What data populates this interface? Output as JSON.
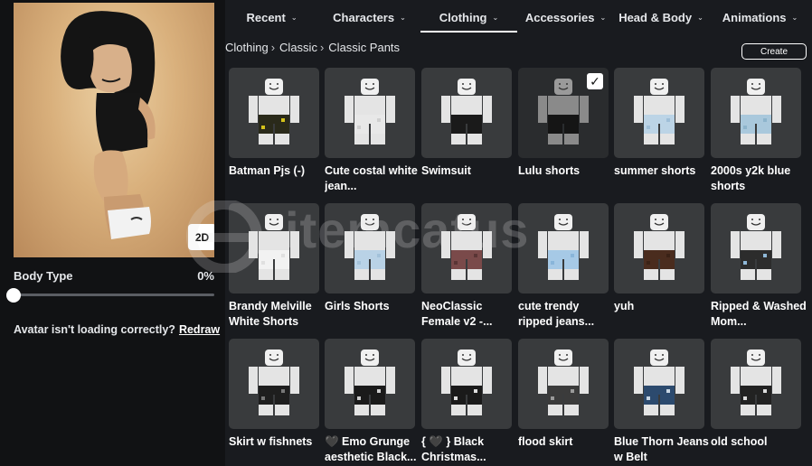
{
  "avatar": {
    "mode_button": "2D",
    "body_type_label": "Body Type",
    "body_type_value": "0%",
    "body_type_level": 0,
    "loading_note": "Avatar isn't loading correctly?",
    "redraw_label": "Redraw"
  },
  "tabs": [
    {
      "label": "Recent",
      "active": false
    },
    {
      "label": "Characters",
      "active": false
    },
    {
      "label": "Clothing",
      "active": true
    },
    {
      "label": "Accessories",
      "active": false
    },
    {
      "label": "Head & Body",
      "active": false
    },
    {
      "label": "Animations",
      "active": false
    }
  ],
  "breadcrumb": [
    "Clothing",
    "Classic",
    "Classic Pants"
  ],
  "create_label": "Create",
  "watermark": "itemcatus",
  "items": [
    {
      "name": "Batman Pjs (-)",
      "pants": "#2a2a1a",
      "accent": "#d4c21a",
      "selected": false
    },
    {
      "name": "Cute costal white jean...",
      "pants": "#e8e8e8",
      "accent": "#d0d0d0",
      "selected": false
    },
    {
      "name": "Swimsuit",
      "pants": "#1a1a1a",
      "accent": "#1a1a1a",
      "selected": false
    },
    {
      "name": "Lulu shorts",
      "pants": "#151515",
      "accent": "#151515",
      "selected": true
    },
    {
      "name": "summer shorts",
      "pants": "#bcd4e6",
      "accent": "#9fbfd8",
      "selected": false
    },
    {
      "name": "2000s y2k blue shorts",
      "pants": "#a9c8dc",
      "accent": "#8db4cc",
      "selected": false
    },
    {
      "name": "Brandy Melville White Shorts",
      "pants": "#f2f2f2",
      "accent": "#e0e0e0",
      "selected": false
    },
    {
      "name": "Girls Shorts",
      "pants": "#b9d2e6",
      "accent": "#a3c2da",
      "selected": false
    },
    {
      "name": "NeoClassic Female v2 -...",
      "pants": "#7a4a4a",
      "accent": "#5a3535",
      "selected": false
    },
    {
      "name": "cute trendy ripped jeans...",
      "pants": "#a6c9e6",
      "accent": "#89b5da",
      "selected": false
    },
    {
      "name": "yuh",
      "pants": "#4a2c1e",
      "accent": "#3a2216",
      "selected": false
    },
    {
      "name": "Ripped & Washed Mom...",
      "pants": "#2c2c2c",
      "accent": "#8fb8d8",
      "selected": false
    },
    {
      "name": "Skirt w fishnets",
      "pants": "#1e1e1e",
      "accent": "#777777",
      "selected": false
    },
    {
      "name": "🖤 Emo Grunge aesthetic Black...",
      "pants": "#1a1a1a",
      "accent": "#cccccc",
      "selected": false
    },
    {
      "name": "{ 🖤 } Black Christmas...",
      "pants": "#1a1a1a",
      "accent": "#dddddd",
      "selected": false
    },
    {
      "name": "flood skirt",
      "pants": "#3b3b3b",
      "accent": "#9a9a9a",
      "selected": false
    },
    {
      "name": "Blue Thorn Jeans w Belt",
      "pants": "#2c4a6e",
      "accent": "#c8d6e4",
      "selected": false
    },
    {
      "name": "old school",
      "pants": "#222222",
      "accent": "#dcdcdc",
      "selected": false
    }
  ]
}
